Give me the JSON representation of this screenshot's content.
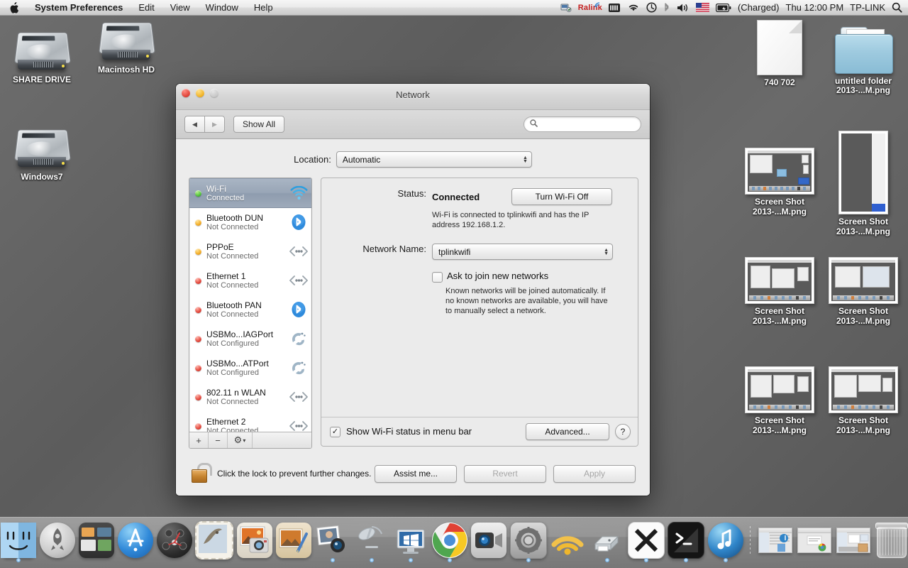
{
  "menubar": {
    "apple_icon": "apple-logo",
    "items": [
      {
        "label": "System Preferences",
        "bold": true
      },
      {
        "label": "Edit",
        "bold": false
      },
      {
        "label": "View",
        "bold": false
      },
      {
        "label": "Window",
        "bold": false
      },
      {
        "label": "Help",
        "bold": false
      }
    ],
    "status": {
      "ralink_label": "Ralink",
      "battery_state": "(Charged)",
      "clock": "Thu 12:00 PM",
      "network_name": "TP-LINK",
      "icons": [
        "ralink-utility-icon",
        "battery-meter-icon",
        "wifi-icon",
        "timemachine-icon",
        "bluetooth-icon",
        "volume-icon",
        "us-flag-input-icon",
        "battery-icon",
        "spotlight-search-icon"
      ]
    }
  },
  "desktop": {
    "icons": [
      {
        "name": "SHARE DRIVE",
        "kind": "harddrive"
      },
      {
        "name": "Macintosh HD",
        "kind": "harddrive"
      },
      {
        "name": "Windows7",
        "kind": "harddrive"
      },
      {
        "name": "740 702",
        "kind": "document"
      },
      {
        "name": "untitled folder",
        "kind": "folder",
        "overlap_label": "2013-...M.png"
      },
      {
        "name": "Screen Shot\n2013-...M.png",
        "kind": "screenshot"
      },
      {
        "name": "Screen Shot\n2013-...M.png",
        "kind": "screenshot-tall"
      },
      {
        "name": "Screen Shot\n2013-...M.png",
        "kind": "screenshot"
      },
      {
        "name": "Screen Shot\n2013-...M.png",
        "kind": "screenshot"
      },
      {
        "name": "Screen Shot\n2013-...M.png",
        "kind": "screenshot"
      },
      {
        "name": "Screen Shot\n2013-...M.png",
        "kind": "screenshot"
      }
    ]
  },
  "window": {
    "title": "Network",
    "toolbar": {
      "back_label": "◀",
      "forward_label": "▶",
      "show_all_label": "Show All",
      "search_placeholder": ""
    },
    "location": {
      "label": "Location:",
      "value": "Automatic"
    },
    "sidebar": {
      "items": [
        {
          "name": "Wi-Fi",
          "status": "Connected",
          "dot": "green",
          "icon": "wifi-icon",
          "selected": true
        },
        {
          "name": "Bluetooth DUN",
          "status": "Not Connected",
          "dot": "amber",
          "icon": "bluetooth-icon",
          "selected": false
        },
        {
          "name": "PPPoE",
          "status": "Not Connected",
          "dot": "amber",
          "icon": "ethernet-icon",
          "selected": false
        },
        {
          "name": "Ethernet 1",
          "status": "Not Connected",
          "dot": "red",
          "icon": "ethernet-icon",
          "selected": false
        },
        {
          "name": "Bluetooth PAN",
          "status": "Not Connected",
          "dot": "red",
          "icon": "bluetooth-icon",
          "selected": false
        },
        {
          "name": "USBMo...IAGPort",
          "status": "Not Configured",
          "dot": "red",
          "icon": "modem-icon",
          "selected": false
        },
        {
          "name": "USBMo...ATPort",
          "status": "Not Configured",
          "dot": "red",
          "icon": "modem-icon",
          "selected": false
        },
        {
          "name": "802.11 n WLAN",
          "status": "Not Connected",
          "dot": "red",
          "icon": "ethernet-icon",
          "selected": false
        },
        {
          "name": "Ethernet 2",
          "status": "Not Connected",
          "dot": "red",
          "icon": "ethernet-icon",
          "selected": false
        }
      ],
      "footer": {
        "add_label": "+",
        "remove_label": "−",
        "gear_label": "⚙",
        "gear_arrow": "▾"
      }
    },
    "panel": {
      "status_label": "Status:",
      "status_value": "Connected",
      "toggle_button": "Turn Wi-Fi Off",
      "status_description": "Wi-Fi is connected to tplinkwifi and has the IP address 192.168.1.2.",
      "network_name_label": "Network Name:",
      "network_name_value": "tplinkwifi",
      "ask_join_label": "Ask to join new networks",
      "ask_join_checked": false,
      "ask_join_description": "Known networks will be joined automatically. If no known networks are available, you will have to manually select a network.",
      "show_status_label": "Show Wi-Fi status in menu bar",
      "show_status_checked": true,
      "checkmark": "✓",
      "advanced_label": "Advanced...",
      "help_label": "?"
    },
    "bottom": {
      "lock_text": "Click the lock to prevent further changes.",
      "assist_label": "Assist me...",
      "revert_label": "Revert",
      "apply_label": "Apply"
    }
  },
  "dock": {
    "items": [
      {
        "name": "Finder",
        "icon": "finder-icon",
        "running": true
      },
      {
        "name": "Launchpad",
        "icon": "launchpad-icon",
        "running": false
      },
      {
        "name": "Mission Control",
        "icon": "mission-control-icon",
        "running": false
      },
      {
        "name": "App Store",
        "icon": "app-store-icon",
        "running": false
      },
      {
        "name": "Dashboard",
        "icon": "dashboard-icon",
        "running": false
      },
      {
        "name": "Mail",
        "icon": "mail-icon",
        "running": false
      },
      {
        "name": "iPhoto",
        "icon": "iphoto-icon",
        "running": false
      },
      {
        "name": "Preview",
        "icon": "preview-icon",
        "running": false
      },
      {
        "name": "Photo Booth",
        "icon": "photo-booth-icon",
        "running": true
      },
      {
        "name": "Remote Desktop",
        "icon": "remote-desktop-icon",
        "running": true
      },
      {
        "name": "Google Chrome",
        "icon": "chrome-icon",
        "running": true
      },
      {
        "name": "FaceTime",
        "icon": "facetime-icon",
        "running": false
      },
      {
        "name": "System Preferences",
        "icon": "system-preferences-icon",
        "running": true
      },
      {
        "name": "AirPort Utility",
        "icon": "airport-utility-icon",
        "running": false
      },
      {
        "name": "Printer",
        "icon": "printer-icon",
        "running": true
      },
      {
        "name": "XQuartz",
        "icon": "xquartz-icon",
        "running": true
      },
      {
        "name": "Terminal",
        "icon": "terminal-icon",
        "running": true
      },
      {
        "name": "iTunes",
        "icon": "itunes-icon",
        "running": true
      }
    ],
    "minimized": [
      {
        "name": "iTunes window",
        "icon": "minimized-window-icon"
      },
      {
        "name": "Document window",
        "icon": "minimized-window-icon"
      },
      {
        "name": "Screenshot window",
        "icon": "minimized-window-icon"
      }
    ],
    "trash": {
      "name": "Trash",
      "icon": "trash-icon"
    }
  }
}
